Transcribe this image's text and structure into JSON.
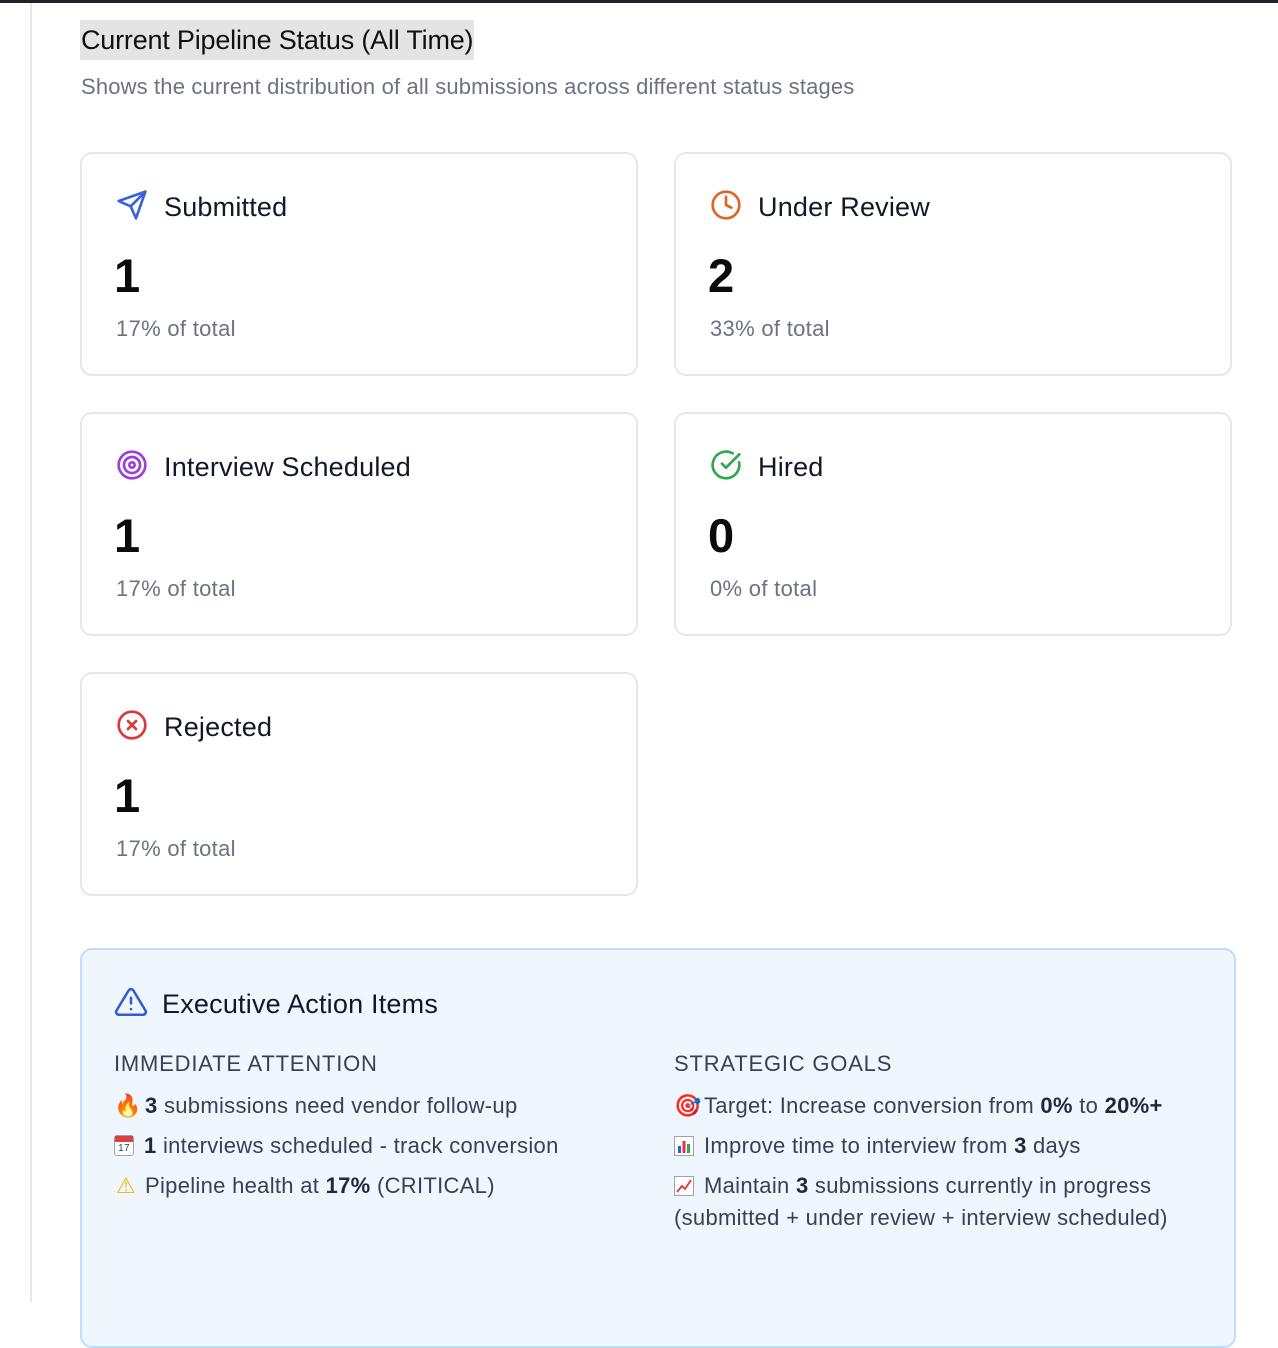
{
  "section": {
    "title": "Current Pipeline Status (All Time)",
    "subtitle": "Shows the current distribution of all submissions across different status stages"
  },
  "cards": [
    {
      "label": "Submitted",
      "icon": "send-icon",
      "color": "#3b63d9",
      "value": "1",
      "percent": "17% of total"
    },
    {
      "label": "Under Review",
      "icon": "clock-icon",
      "color": "#e0652a",
      "value": "2",
      "percent": "33% of total"
    },
    {
      "label": "Interview Scheduled",
      "icon": "target-icon",
      "color": "#9b3fd6",
      "value": "1",
      "percent": "17% of total"
    },
    {
      "label": "Hired",
      "icon": "check-circle-icon",
      "color": "#2fa84f",
      "value": "0",
      "percent": "0% of total"
    },
    {
      "label": "Rejected",
      "icon": "x-circle-icon",
      "color": "#d93a3a",
      "value": "1",
      "percent": "17% of total"
    }
  ],
  "actions": {
    "title": "Executive Action Items",
    "icon": "warning-triangle-icon",
    "immediate": {
      "heading": "IMMEDIATE ATTENTION",
      "items": [
        {
          "icon": "fire-emoji",
          "bold": "3",
          "text": " submissions need vendor follow-up"
        },
        {
          "icon": "calendar-emoji",
          "calendar_day": "17",
          "bold": "1",
          "text": " interviews scheduled - track conversion"
        },
        {
          "icon": "warning-emoji",
          "pre": "Pipeline health at ",
          "bold": "17%",
          "text": " (CRITICAL)"
        }
      ]
    },
    "strategic": {
      "heading": "STRATEGIC GOALS",
      "items": [
        {
          "icon": "dart-emoji",
          "pre": "Target: Increase conversion from ",
          "bold": "0%",
          "mid": " to ",
          "bold2": "20%+"
        },
        {
          "icon": "bar-chart-emoji",
          "pre": "Improve time to interview from ",
          "bold": "3",
          "text": " days"
        },
        {
          "icon": "trend-up-emoji",
          "pre": "Maintain ",
          "bold": "3",
          "text": " submissions currently in progress (submitted + under review + interview scheduled)"
        }
      ]
    }
  }
}
